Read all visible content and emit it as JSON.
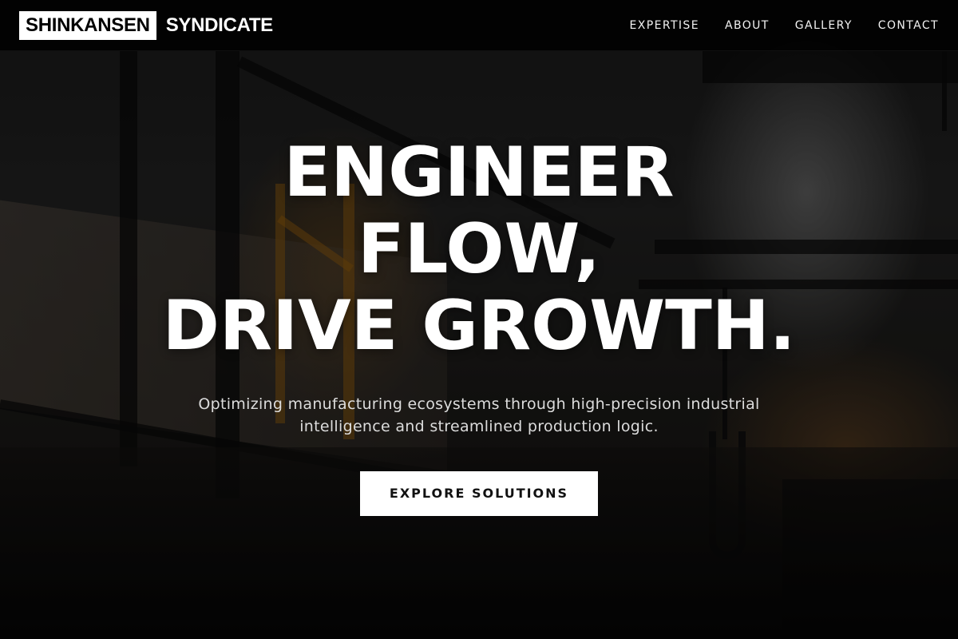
{
  "header": {
    "logo_boxed": "SHINKANSEN",
    "logo_word": "SYNDICATE",
    "nav": [
      {
        "label": "EXPERTISE"
      },
      {
        "label": "ABOUT"
      },
      {
        "label": "GALLERY"
      },
      {
        "label": "CONTACT"
      }
    ]
  },
  "hero": {
    "title_lines": [
      "ENGINEER",
      "FLOW,",
      "DRIVE GROWTH."
    ],
    "subtitle": "Optimizing manufacturing ecosystems through high-precision industrial intelligence and streamlined production logic.",
    "cta_label": "EXPLORE SOLUTIONS"
  },
  "colors": {
    "header_bg": "#000000",
    "cta_bg": "#ffffff",
    "cta_text": "#111111",
    "accent_orange": "#965f0f"
  }
}
